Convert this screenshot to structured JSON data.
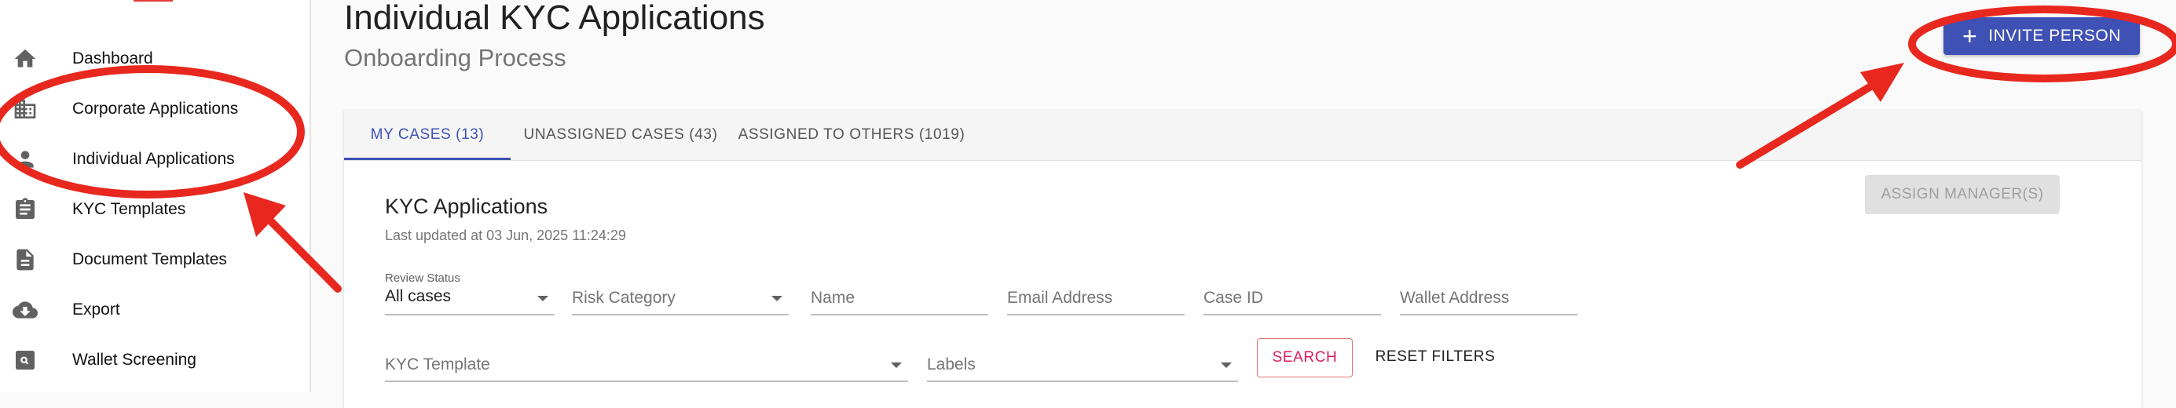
{
  "sidebar": {
    "items": [
      {
        "label": "Dashboard",
        "icon": "home-icon"
      },
      {
        "label": "Corporate Applications",
        "icon": "building-icon"
      },
      {
        "label": "Individual Applications",
        "icon": "person-icon"
      },
      {
        "label": "KYC Templates",
        "icon": "clipboard-icon"
      },
      {
        "label": "Document Templates",
        "icon": "document-icon"
      },
      {
        "label": "Export",
        "icon": "cloud-download-icon"
      },
      {
        "label": "Wallet Screening",
        "icon": "search-document-icon"
      }
    ]
  },
  "header": {
    "title": "Individual KYC Applications",
    "subtitle": "Onboarding Process",
    "invite_label": "INVITE PERSON"
  },
  "tabs": [
    {
      "label": "MY CASES (13)",
      "active": true
    },
    {
      "label": "UNASSIGNED CASES (43)",
      "active": false
    },
    {
      "label": "ASSIGNED TO OTHERS (1019)",
      "active": false
    }
  ],
  "panel": {
    "title": "KYC Applications",
    "last_updated": "Last updated at 03 Jun, 2025 11:24:29",
    "assign_label": "ASSIGN MANAGER(S)"
  },
  "filters": {
    "review_status_label": "Review Status",
    "review_status_value": "All cases",
    "risk_category": "Risk Category",
    "name": "Name",
    "email": "Email Address",
    "case_id": "Case ID",
    "wallet_address": "Wallet Address",
    "kyc_template": "KYC Template",
    "labels": "Labels",
    "search_label": "SEARCH",
    "reset_label": "RESET FILTERS"
  },
  "colors": {
    "primary": "#3f51b5",
    "annotation": "#e8281e",
    "search_accent": "#d81b60"
  }
}
